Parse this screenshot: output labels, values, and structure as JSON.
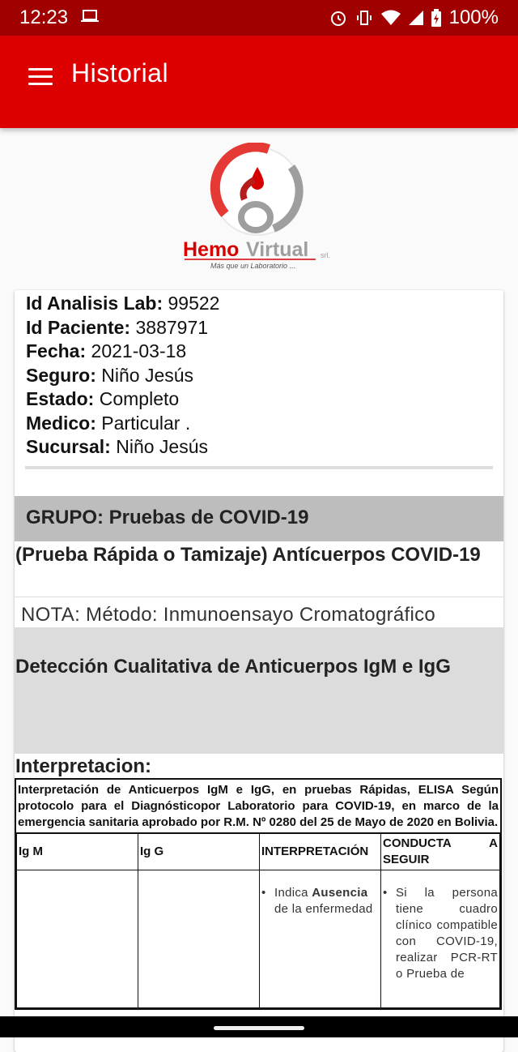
{
  "status": {
    "time": "12:23",
    "battery": "100%"
  },
  "appbar": {
    "title": "Historial"
  },
  "logo": {
    "brand_a": "Hemo",
    "brand_b": "Virtual",
    "suffix": "srl.",
    "tagline": "Más que un Laboratorio ..."
  },
  "info": [
    {
      "label": "Id Analisis Lab:",
      "value": "99522"
    },
    {
      "label": "Id Paciente:",
      "value": "3887971"
    },
    {
      "label": "Fecha:",
      "value": "2021-03-18"
    },
    {
      "label": "Seguro:",
      "value": "Niño Jesús"
    },
    {
      "label": "Estado:",
      "value": "Completo"
    },
    {
      "label": "Medico:",
      "value": "Particular ."
    },
    {
      "label": "Sucursal:",
      "value": "Niño Jesús"
    }
  ],
  "group": "GRUPO: Pruebas de COVID-19",
  "test_name": "(Prueba Rápida o Tamizaje) Antícuerpos COVID-19",
  "nota": "NOTA: Método: Inmunoensayo Cromatográfico",
  "deteccion": "Detección Cualitativa de Anticuerpos IgM e IgG",
  "interpretacion_title": "Interpretacion:",
  "table": {
    "heading": "Interpretación de Anticuerpos IgM e IgG, en pruebas Rápidas, ELISA Según protocolo para el Diagnósticopor Laboratorio para COVID-19, en marco de la emergencia sanitaria aprobado por R.M. Nº 0280 del 25 de Mayo de 2020 en Bolivia.",
    "columns": [
      "Ig M",
      "Ig G",
      "INTERPRETACIÓN",
      "CONDUCTA A SEGUIR"
    ],
    "row1": {
      "igm": "",
      "igg": "",
      "interp_a": "Indica",
      "interp_b": "Ausencia",
      "interp_c": "de la enfermedad",
      "conducta": "Si la persona tiene cuadro clínico compatible con COVID-19, realizar PCR-RT o Prueba de"
    }
  }
}
